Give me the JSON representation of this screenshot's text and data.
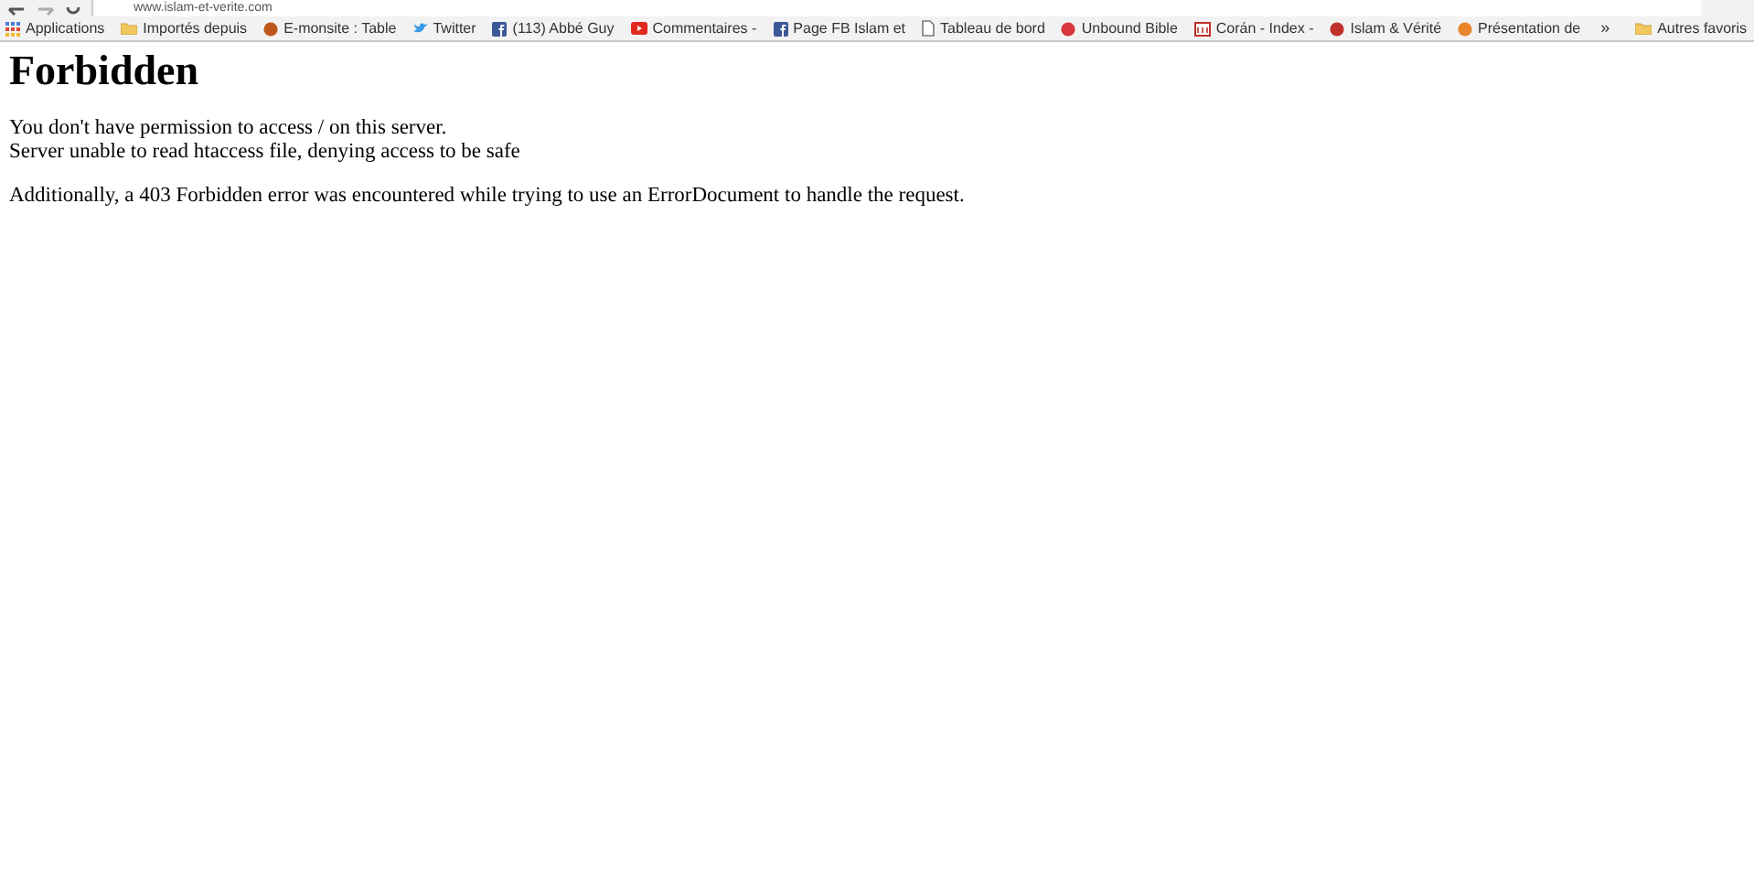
{
  "address_bar": {
    "url": "www.islam-et-verite.com"
  },
  "bookmarks": [
    {
      "kind": "apps",
      "label": "Applications"
    },
    {
      "kind": "folder",
      "label": "Importés depuis"
    },
    {
      "kind": "site",
      "label": "E-monsite : Table",
      "color": "#c0571a"
    },
    {
      "kind": "bird",
      "label": "Twitter"
    },
    {
      "kind": "fb",
      "label": "(113) Abbé Guy"
    },
    {
      "kind": "play",
      "label": "Commentaires -"
    },
    {
      "kind": "fb",
      "label": "Page FB Islam et"
    },
    {
      "kind": "page",
      "label": "Tableau de bord"
    },
    {
      "kind": "site",
      "label": "Unbound Bible",
      "color": "#d9363e"
    },
    {
      "kind": "calendar",
      "label": "Corán - Index -"
    },
    {
      "kind": "site",
      "label": "Islam & Vérité",
      "color": "#c0302a"
    },
    {
      "kind": "site",
      "label": "Présentation de",
      "color": "#e8842a"
    }
  ],
  "overflow": "»",
  "other_bookmarks": "Autres favoris",
  "heading": "Forbidden",
  "paragraphs": [
    [
      "You don't have permission to access / on this server.",
      "Server unable to read htaccess file, denying access to be safe"
    ],
    [
      "Additionally, a 403 Forbidden error was encountered while trying to use an ErrorDocument to handle the request."
    ]
  ]
}
